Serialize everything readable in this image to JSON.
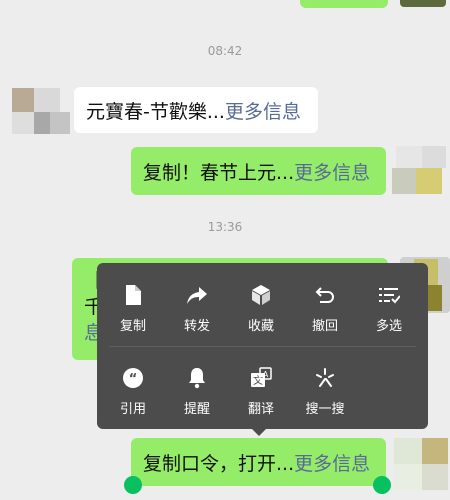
{
  "timestamps": [
    "08:42",
    "13:36"
  ],
  "messages": [
    {
      "text": "元寶春-节歡樂...",
      "more": "更多信息"
    },
    {
      "text": "复制！春节上元...",
      "more": "更多信息"
    },
    {
      "prefix": "【",
      "line2": "千",
      "line3": "息"
    },
    {
      "text": "复制口令，打开...",
      "more": "更多信息"
    }
  ],
  "context_menu": {
    "row1": [
      {
        "label": "复制",
        "icon": "copy-icon"
      },
      {
        "label": "转发",
        "icon": "forward-icon"
      },
      {
        "label": "收藏",
        "icon": "favorite-cube-icon"
      },
      {
        "label": "撤回",
        "icon": "undo-icon"
      },
      {
        "label": "多选",
        "icon": "multiselect-icon"
      }
    ],
    "row2": [
      {
        "label": "引用",
        "icon": "quote-icon"
      },
      {
        "label": "提醒",
        "icon": "bell-icon"
      },
      {
        "label": "翻译",
        "icon": "translate-icon"
      },
      {
        "label": "搜一搜",
        "icon": "search-sparkle-icon"
      }
    ]
  },
  "colors": {
    "bubble_green": "#95ec69",
    "link": "#576b95",
    "menu_bg": "#4c4c4c",
    "handle": "#07c160",
    "background": "#ededed"
  }
}
